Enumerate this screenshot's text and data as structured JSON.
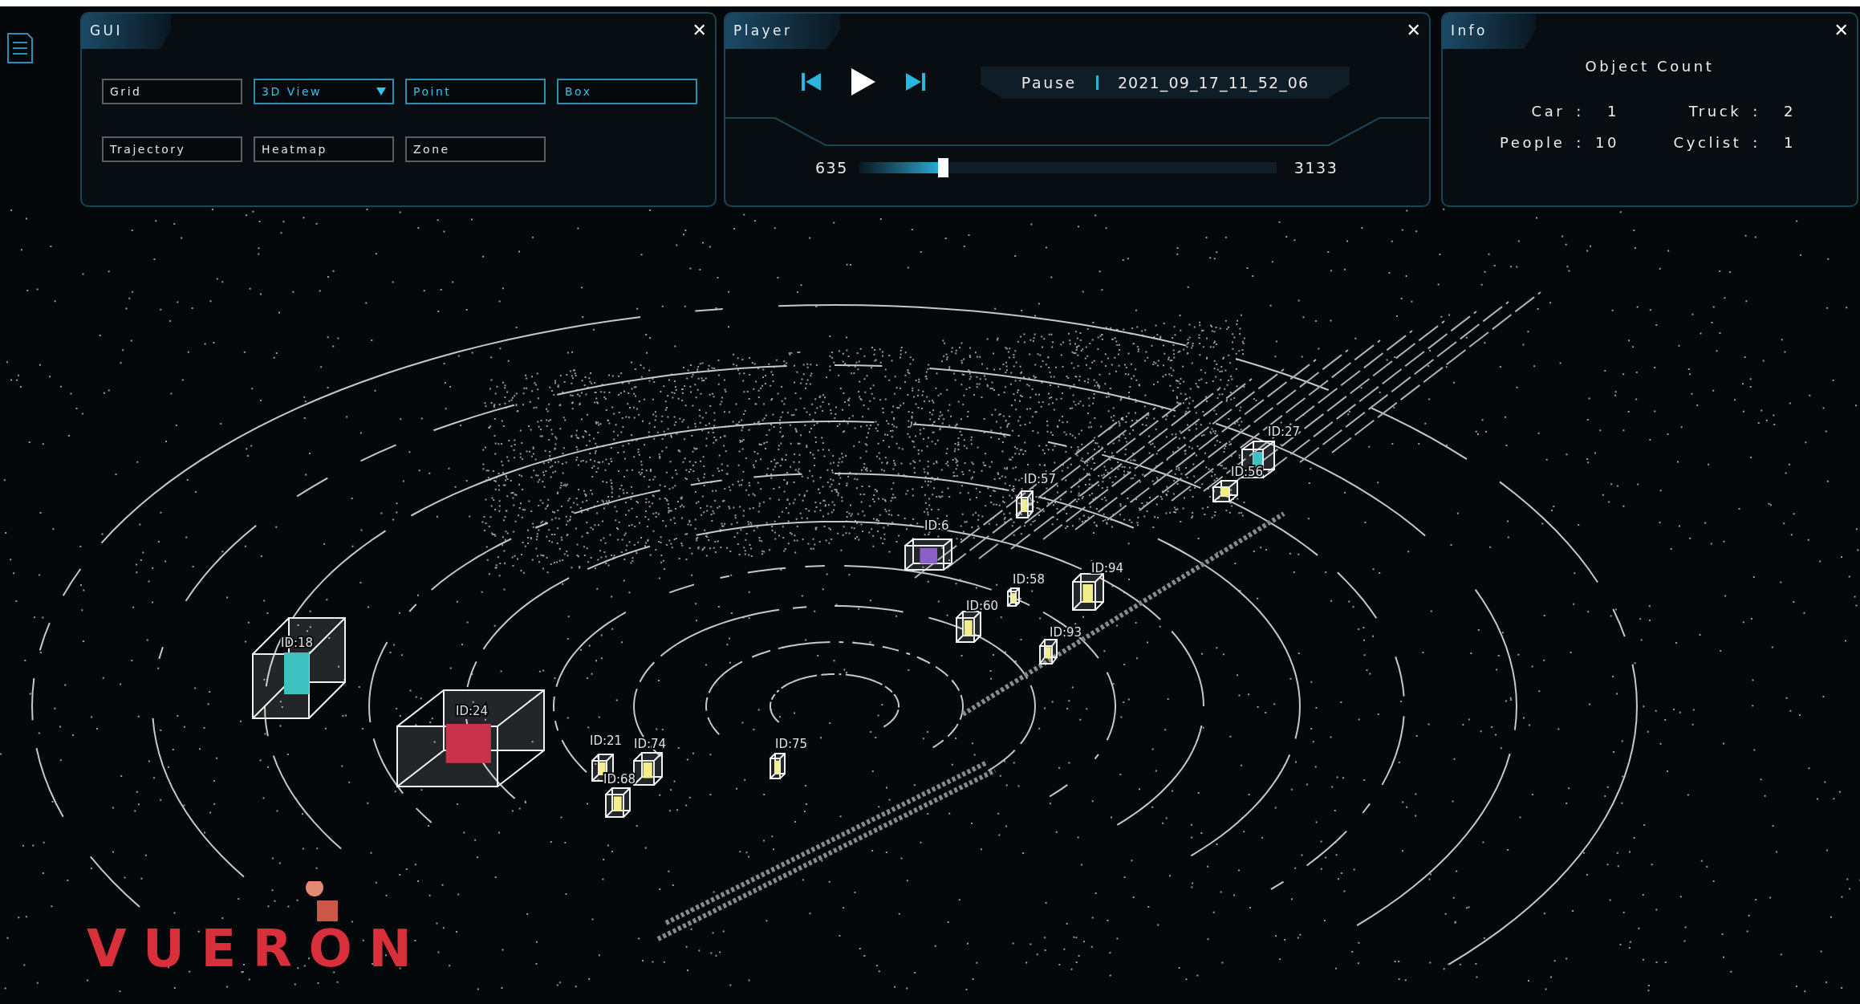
{
  "gui_panel": {
    "title": "GUI",
    "close": "✕",
    "buttons": [
      {
        "label": "Grid",
        "kind": "toggle",
        "selected": false
      },
      {
        "label": "3D View",
        "kind": "dropdown",
        "selected": true
      },
      {
        "label": "Point",
        "kind": "toggle",
        "selected": true
      },
      {
        "label": "Box",
        "kind": "toggle",
        "selected": true
      },
      {
        "label": "Trajectory",
        "kind": "toggle",
        "selected": false
      },
      {
        "label": "Heatmap",
        "kind": "toggle",
        "selected": false
      },
      {
        "label": "Zone",
        "kind": "toggle",
        "selected": false
      }
    ]
  },
  "player": {
    "title": "Player",
    "close": "✕",
    "state": "Pause",
    "timestamp": "2021_09_17_11_52_06",
    "start": "635",
    "end": "3133",
    "level": 0.2
  },
  "info": {
    "title": "Info",
    "close": "✕",
    "heading": "Object Count",
    "counts": [
      {
        "label": "Car",
        "separator": ":",
        "value": "1"
      },
      {
        "label": "Truck",
        "separator": ":",
        "value": "2"
      },
      {
        "label": "People",
        "separator": ":",
        "value": "10"
      },
      {
        "label": "Cyclist",
        "separator": ":",
        "value": "1"
      }
    ]
  },
  "scene": {
    "objects": [
      {
        "label": "ID:18",
        "color": "#3fc1c0"
      },
      {
        "label": "ID:24",
        "color": "#c8324a"
      },
      {
        "label": "ID:21",
        "color": "#f2ee8a"
      },
      {
        "label": "ID:74",
        "color": "#f2ee8a"
      },
      {
        "label": "ID:68",
        "color": "#f2ee8a"
      },
      {
        "label": "ID:75",
        "color": "#f2ee8a"
      },
      {
        "label": "ID:6",
        "color": "#8a5fc9"
      },
      {
        "label": "ID:57",
        "color": "#f2ee8a"
      },
      {
        "label": "ID:27",
        "color": "#3fc1c0"
      },
      {
        "label": "ID:56",
        "color": "#f2ee8a"
      },
      {
        "label": "ID:58",
        "color": "#f2ee8a"
      },
      {
        "label": "ID:94",
        "color": "#f2ee8a"
      },
      {
        "label": "ID:60",
        "color": "#f2ee8a"
      },
      {
        "label": "ID:93",
        "color": "#f2ee8a"
      }
    ]
  },
  "logo": {
    "text": "VUERON"
  }
}
